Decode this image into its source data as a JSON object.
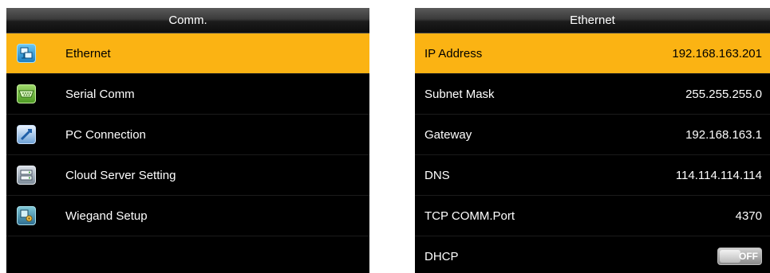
{
  "comm_screen": {
    "title": "Comm.",
    "items": [
      {
        "label": "Ethernet",
        "icon": "network-icon",
        "selected": true
      },
      {
        "label": "Serial Comm",
        "icon": "serial-port-icon",
        "selected": false
      },
      {
        "label": "PC Connection",
        "icon": "pc-connection-icon",
        "selected": false
      },
      {
        "label": "Cloud Server Setting",
        "icon": "cloud-server-icon",
        "selected": false
      },
      {
        "label": "Wiegand Setup",
        "icon": "wiegand-settings-icon",
        "selected": false
      }
    ]
  },
  "ethernet_screen": {
    "title": "Ethernet",
    "rows": [
      {
        "label": "IP Address",
        "value": "192.168.163.201",
        "selected": true
      },
      {
        "label": "Subnet Mask",
        "value": "255.255.255.0",
        "selected": false
      },
      {
        "label": "Gateway",
        "value": "192.168.163.1",
        "selected": false
      },
      {
        "label": "DNS",
        "value": "114.114.114.114",
        "selected": false
      },
      {
        "label": "TCP COMM.Port",
        "value": "4370",
        "selected": false
      }
    ],
    "dhcp": {
      "label": "DHCP",
      "state": "OFF"
    }
  },
  "colors": {
    "highlight": "#fbb313",
    "screen_background": "#000000",
    "text": "#ffffff"
  }
}
